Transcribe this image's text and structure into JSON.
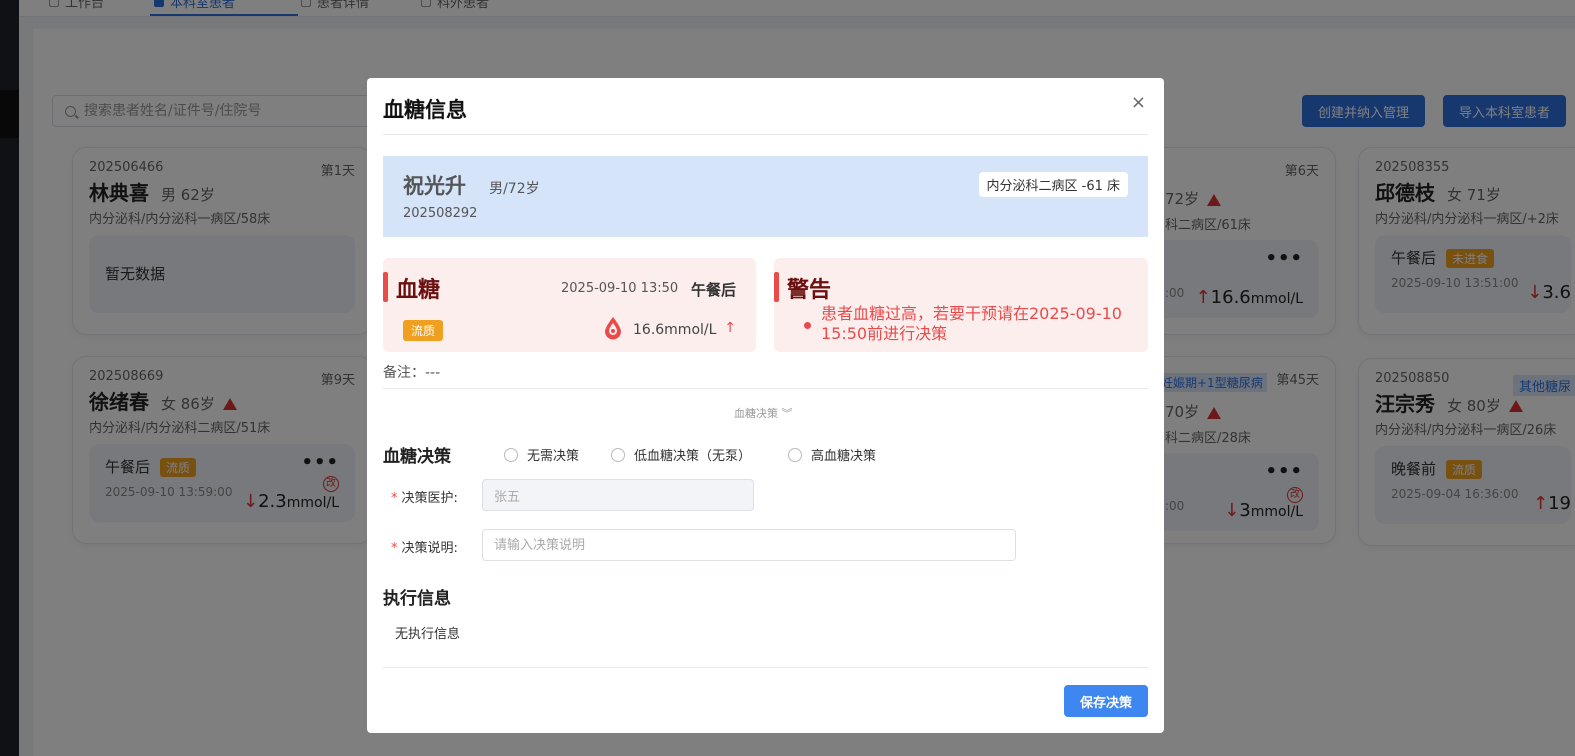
{
  "nav": {
    "tabs": [
      "工作台",
      "本科室患者",
      "患者详情",
      "科外患者"
    ]
  },
  "toolbar": {
    "search_placeholder": "搜索患者姓名/证件号/住院号",
    "create_label": "创建并纳入管理",
    "import_label": "导入本科室患者"
  },
  "cards": [
    {
      "id": "202506466",
      "day": "第1天",
      "name": "林典喜",
      "sexage": "男  62岁",
      "dept": "内分泌科/内分泌科一病区/58床",
      "empty": "暂无数据"
    },
    {
      "id": "202508669",
      "day": "第9天",
      "name": "徐绪春",
      "sexage": "女  86岁",
      "dept": "内分泌科/内分泌科二病区/51床",
      "meal": "午餐后",
      "tag": "流质",
      "time": "2025-09-10 13:59:00",
      "arrow": "↓",
      "value": "2.3",
      "unit": "mmol/L",
      "badge": "改"
    },
    {
      "day": "第6天",
      "sexage": "72岁",
      "dept": "科二病区/61床",
      "time": ":00",
      "arrow": "↑",
      "value": "16.6",
      "unit": "mmol/L"
    },
    {
      "tag": "妊娠期+1型糖尿病",
      "day": "第45天",
      "sexage": "70岁",
      "dept": "科二病区/28床",
      "time": ":00",
      "arrow": "↓",
      "value": "3",
      "unit": "mmol/L",
      "badge": "改"
    },
    {
      "id": "202508355",
      "name": "邱德枝",
      "sexage": "女  71岁",
      "dept": "内分泌科/内分泌科一病区/+2床",
      "meal": "午餐后",
      "tag": "未进食",
      "time": "2025-09-10 13:51:00",
      "arrow": "↓",
      "value": "3.6"
    },
    {
      "id": "202508850",
      "tag": "其他糖尿",
      "name": "汪宗秀",
      "sexage": "女  80岁",
      "dept": "内分泌科/内分泌科一病区/26床",
      "meal": "晚餐前",
      "tag2": "流质",
      "time": "2025-09-04 16:36:00",
      "arrow": "↑",
      "value": "19"
    }
  ],
  "modal": {
    "title": "血糖信息",
    "close": "×",
    "patient": {
      "name": "祝光升",
      "gender_age": "男/72岁",
      "number": "202508292",
      "bed": "内分泌科二病区 -61 床"
    },
    "glucose": {
      "title": "血糖",
      "datetime": "2025-09-10 13:50",
      "meal": "午餐后",
      "diet_tag": "流质",
      "value": "16.6mmol/L",
      "trend": "↑"
    },
    "warning": {
      "title": "警告",
      "message": "患者血糖过高，若要干预请在2025-09-10 15:50前进行决策"
    },
    "remark": "备注：---",
    "collapse_label": "血糖决策 ︾",
    "decision": {
      "title": "血糖决策",
      "options": [
        "无需决策",
        "低血糖决策（无泵）",
        "高血糖决策"
      ],
      "doctor_label": "决策医护:",
      "doctor_value": "张五",
      "note_label": "决策说明:",
      "note_placeholder": "请输入决策说明",
      "required_mark": "*"
    },
    "execution": {
      "title": "执行信息",
      "empty": "无执行信息"
    },
    "save_label": "保存决策"
  }
}
